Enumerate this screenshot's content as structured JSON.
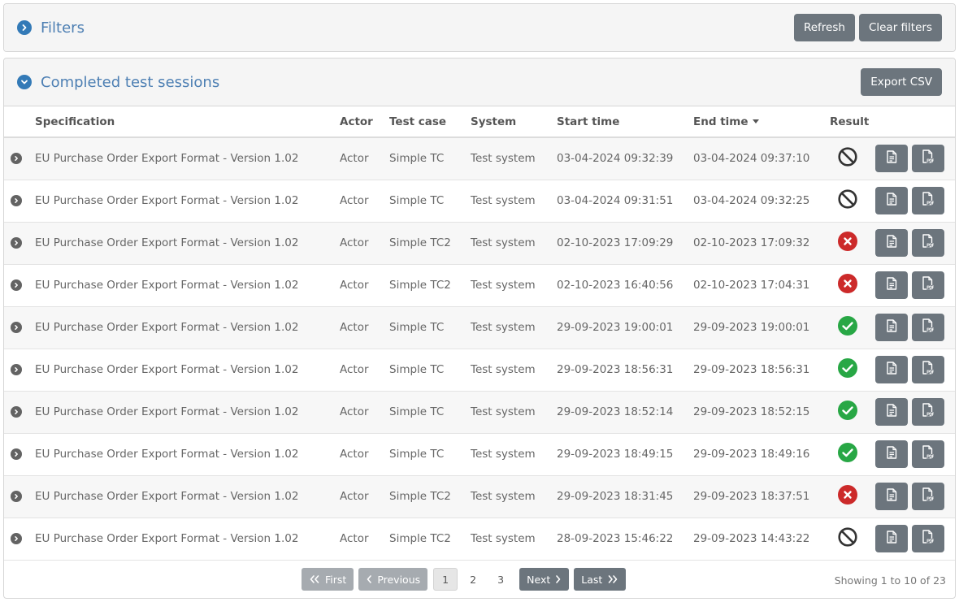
{
  "filters": {
    "title": "Filters",
    "refresh_label": "Refresh",
    "clear_label": "Clear filters"
  },
  "sessions": {
    "title": "Completed test sessions",
    "export_label": "Export CSV",
    "columns": [
      "Specification",
      "Actor",
      "Test case",
      "System",
      "Start time",
      "End time",
      "Result"
    ],
    "rows": [
      {
        "spec": "EU Purchase Order Export Format - Version 1.02",
        "actor": "Actor",
        "test_case": "Simple TC",
        "system": "Test system",
        "start": "03-04-2024 09:32:39",
        "end": "03-04-2024 09:37:10",
        "result": "undefined"
      },
      {
        "spec": "EU Purchase Order Export Format - Version 1.02",
        "actor": "Actor",
        "test_case": "Simple TC",
        "system": "Test system",
        "start": "03-04-2024 09:31:51",
        "end": "03-04-2024 09:32:25",
        "result": "undefined"
      },
      {
        "spec": "EU Purchase Order Export Format - Version 1.02",
        "actor": "Actor",
        "test_case": "Simple TC2",
        "system": "Test system",
        "start": "02-10-2023 17:09:29",
        "end": "02-10-2023 17:09:32",
        "result": "failure"
      },
      {
        "spec": "EU Purchase Order Export Format - Version 1.02",
        "actor": "Actor",
        "test_case": "Simple TC2",
        "system": "Test system",
        "start": "02-10-2023 16:40:56",
        "end": "02-10-2023 17:04:31",
        "result": "failure"
      },
      {
        "spec": "EU Purchase Order Export Format - Version 1.02",
        "actor": "Actor",
        "test_case": "Simple TC",
        "system": "Test system",
        "start": "29-09-2023 19:00:01",
        "end": "29-09-2023 19:00:01",
        "result": "success"
      },
      {
        "spec": "EU Purchase Order Export Format - Version 1.02",
        "actor": "Actor",
        "test_case": "Simple TC",
        "system": "Test system",
        "start": "29-09-2023 18:56:31",
        "end": "29-09-2023 18:56:31",
        "result": "success"
      },
      {
        "spec": "EU Purchase Order Export Format - Version 1.02",
        "actor": "Actor",
        "test_case": "Simple TC",
        "system": "Test system",
        "start": "29-09-2023 18:52:14",
        "end": "29-09-2023 18:52:15",
        "result": "success"
      },
      {
        "spec": "EU Purchase Order Export Format - Version 1.02",
        "actor": "Actor",
        "test_case": "Simple TC",
        "system": "Test system",
        "start": "29-09-2023 18:49:15",
        "end": "29-09-2023 18:49:16",
        "result": "success"
      },
      {
        "spec": "EU Purchase Order Export Format - Version 1.02",
        "actor": "Actor",
        "test_case": "Simple TC2",
        "system": "Test system",
        "start": "29-09-2023 18:31:45",
        "end": "29-09-2023 18:37:51",
        "result": "failure"
      },
      {
        "spec": "EU Purchase Order Export Format - Version 1.02",
        "actor": "Actor",
        "test_case": "Simple TC2",
        "system": "Test system",
        "start": "28-09-2023 15:46:22",
        "end": "29-09-2023 14:43:22",
        "result": "undefined"
      }
    ]
  },
  "pagination": {
    "first": "First",
    "previous": "Previous",
    "pages": [
      "1",
      "2",
      "3"
    ],
    "current": "1",
    "next": "Next",
    "last": "Last",
    "showing": "Showing 1 to 10 of 23"
  },
  "colors": {
    "success": "#28a745",
    "failure": "#cc2a2a",
    "undefined": "#333333",
    "button": "#6c757d",
    "title": "#4d7fb3"
  },
  "icons": {
    "row_expand": "chevron-right-circle-icon",
    "report": "document-icon",
    "pdf": "pdf-file-icon",
    "success": "check-circle-icon",
    "failure": "x-circle-icon",
    "undefined": "ban-icon"
  }
}
